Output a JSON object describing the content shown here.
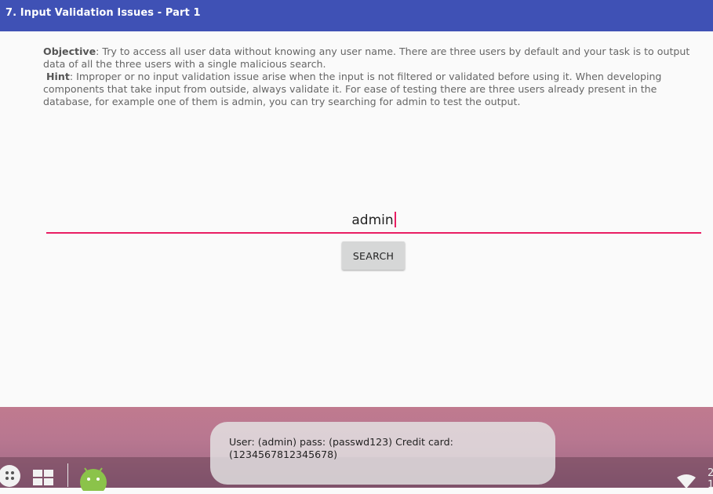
{
  "app_bar": {
    "title": "7. Input Validation Issues - Part 1"
  },
  "description": {
    "objective_label": "Objective",
    "objective_text": ": Try to access all user data without knowing any user name. There are three users by default and your task is to output data of all the three users with a single malicious search.",
    "hint_label": "Hint",
    "hint_text": ": Improper or no input validation issue arise when the input is not filtered or validated before using it. When developing components that take input from outside, always validate it. For ease of testing there are three users already present in the database, for example one of them is admin, you can try searching for admin to test the output."
  },
  "search": {
    "input_value": "admin",
    "button_label": "SEARCH"
  },
  "toast": {
    "message": "User: (admin) pass: (passwd123) Credit card: (1234567812345678)"
  },
  "taskbar": {
    "icons": [
      "app-drawer-icon",
      "grid-icon",
      "android-icon",
      "wifi-icon"
    ],
    "clock_text": "2\n1"
  },
  "colors": {
    "app_bar": "#3f51b5",
    "accent": "#e91e63",
    "button": "#d6d7d7"
  }
}
